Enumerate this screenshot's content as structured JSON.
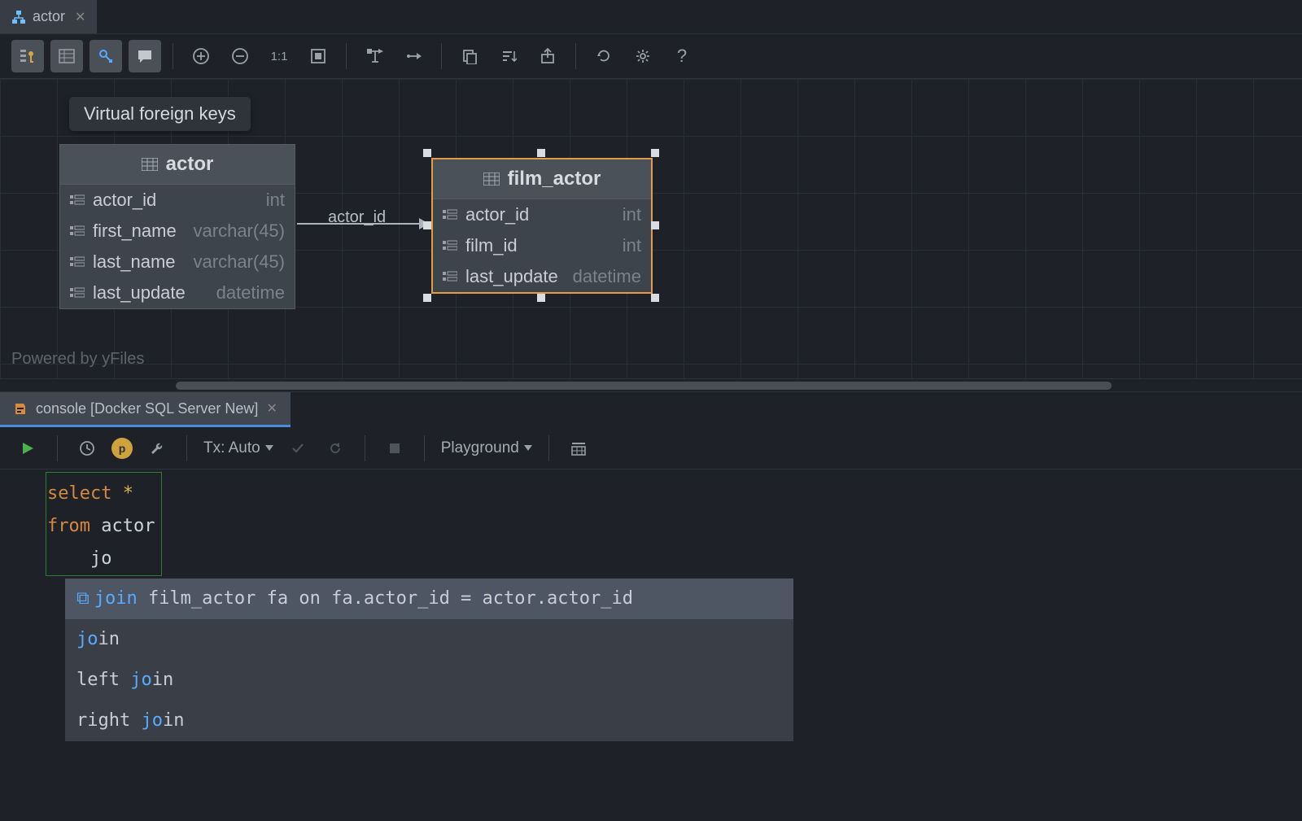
{
  "top_tab": {
    "label": "actor"
  },
  "tooltip": "Virtual foreign keys",
  "relation_label": "actor_id",
  "powered": "Powered by yFiles",
  "entity_actor": {
    "name": "actor",
    "cols": [
      {
        "name": "actor_id",
        "type": "int"
      },
      {
        "name": "first_name",
        "type": "varchar(45)"
      },
      {
        "name": "last_name",
        "type": "varchar(45)"
      },
      {
        "name": "last_update",
        "type": "datetime"
      }
    ]
  },
  "entity_film_actor": {
    "name": "film_actor",
    "cols": [
      {
        "name": "actor_id",
        "type": "int"
      },
      {
        "name": "film_id",
        "type": "int"
      },
      {
        "name": "last_update",
        "type": "datetime"
      }
    ]
  },
  "console_tab": {
    "label": "console [Docker SQL Server New]"
  },
  "tx_mode": "Tx: Auto",
  "playground": "Playground",
  "code": {
    "l1_kw": "select ",
    "l1_star": "*",
    "l2_kw": "from ",
    "l2_id": "actor",
    "l3_typed": "jo"
  },
  "suggestions": [
    {
      "text_before": "",
      "kw": "join",
      "text_after": " film_actor fa on fa.actor_id = actor.actor_id",
      "selected": true,
      "icon": true
    },
    {
      "text_before": "",
      "kw": "jo",
      "kw_rest": "in",
      "text_after": "",
      "selected": false
    },
    {
      "text_before": "left ",
      "kw": "jo",
      "kw_rest": "in",
      "text_after": "",
      "selected": false
    },
    {
      "text_before": "right ",
      "kw": "jo",
      "kw_rest": "in",
      "text_after": "",
      "selected": false
    }
  ]
}
